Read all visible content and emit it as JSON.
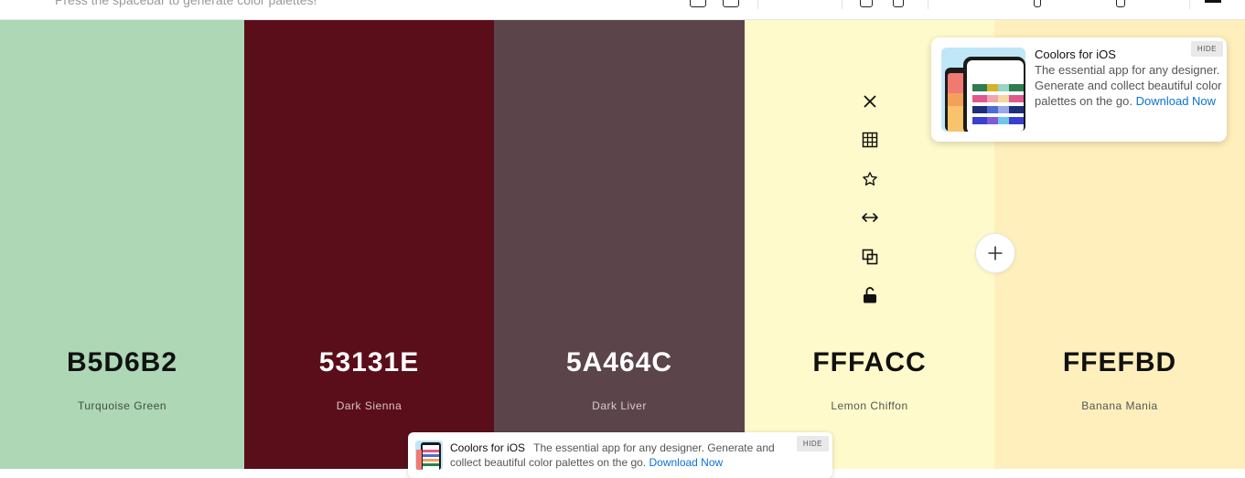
{
  "topbar": {
    "ghost_text": "Press the spacebar to generate color palettes!"
  },
  "palette": [
    {
      "hex": "B5D6B2",
      "name": "Turquoise Green",
      "bg": "#ADD7B5",
      "fg": "#111111",
      "sub": "#3f4e3f"
    },
    {
      "hex": "53131E",
      "name": "Dark Sienna",
      "bg": "#5A0E1A",
      "fg": "#ffffff",
      "sub": "#d9c2c6"
    },
    {
      "hex": "5A464C",
      "name": "Dark Liver",
      "bg": "#5C444B",
      "fg": "#ffffff",
      "sub": "#d6cbcd"
    },
    {
      "hex": "FFFACC",
      "name": "Lemon Chiffon",
      "bg": "#FFFACB",
      "fg": "#111111",
      "sub": "#555555"
    },
    {
      "hex": "FFEFBD",
      "name": "Banana Mania",
      "bg": "#FFEFBC",
      "fg": "#111111",
      "sub": "#555555"
    }
  ],
  "tools": [
    "close-icon",
    "grid-icon",
    "star-icon",
    "arrows-horizontal-icon",
    "copy-icon",
    "unlock-icon"
  ],
  "add_button": {
    "icon": "plus-icon"
  },
  "ad_card": {
    "title": "Coolors for iOS",
    "description": "The essential app for any designer. Generate and collect beautiful color palettes on the go.",
    "link": "Download Now",
    "hide": "HIDE"
  },
  "ad_bar": {
    "title": "Coolors for iOS",
    "description": "The essential app for any designer. Generate and collect beautiful color palettes on the go.",
    "link": "Download Now",
    "hide": "HIDE"
  },
  "colors": {
    "link": "#0a73d6"
  }
}
